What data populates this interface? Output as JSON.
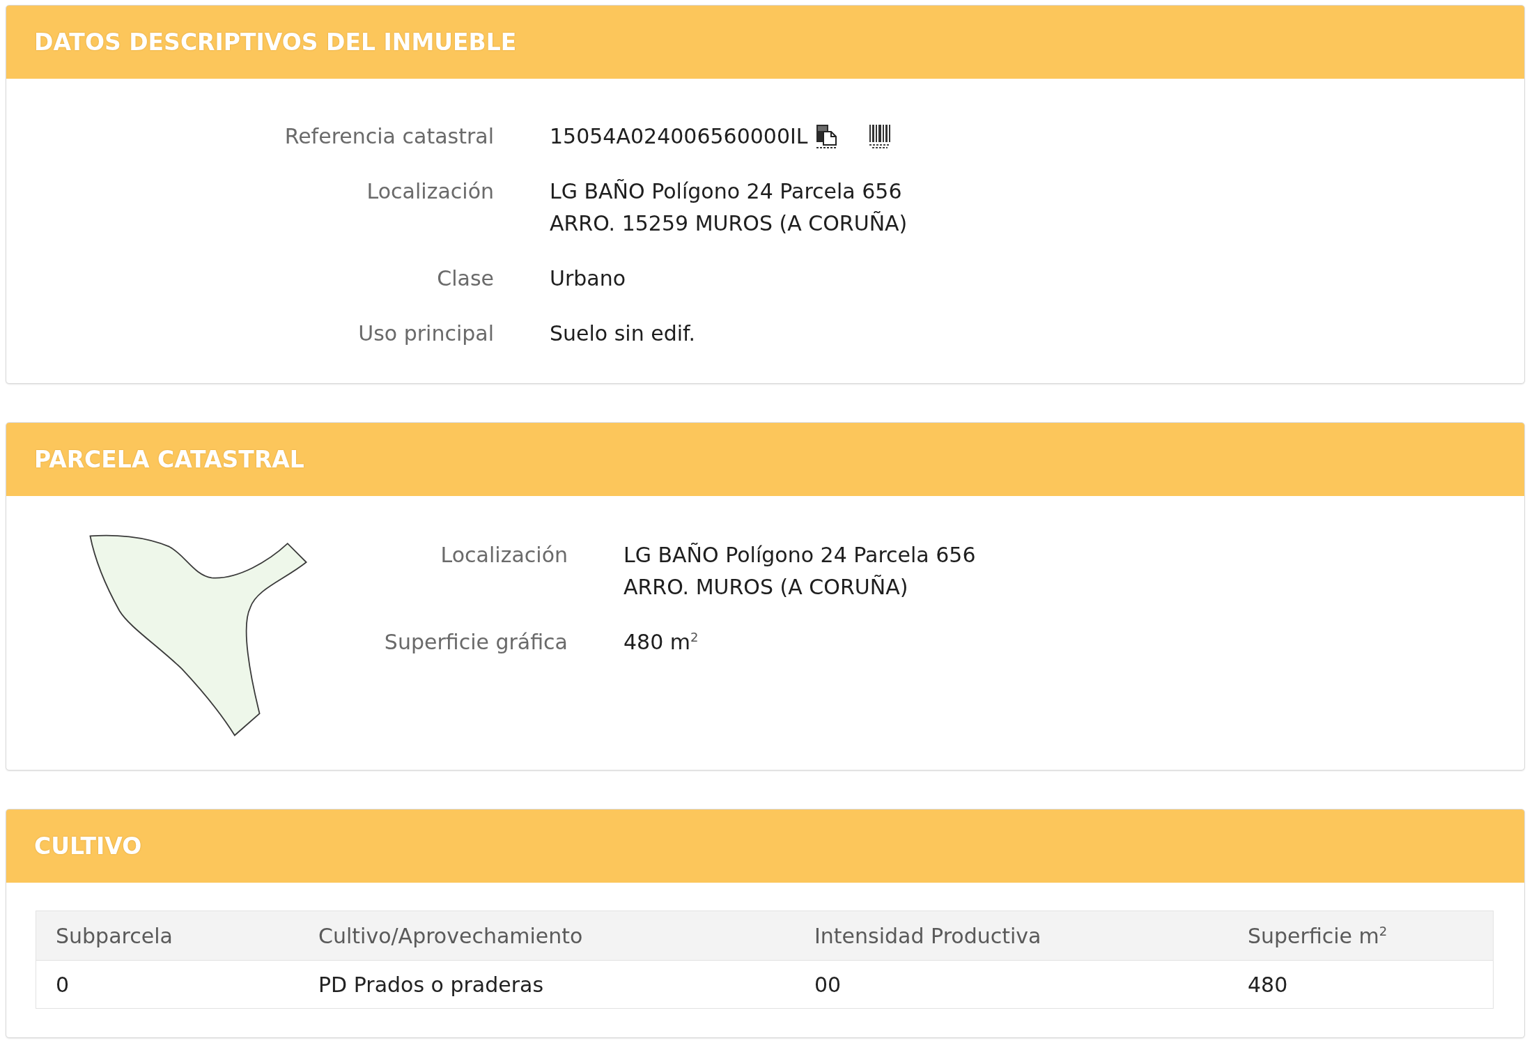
{
  "sections": [
    {
      "kind": "fields",
      "title": "DATOS DESCRIPTIVOS DEL INMUEBLE",
      "fields": [
        {
          "kind": "reference",
          "label": "Referencia catastral",
          "value": [
            "15054A024006560000IL"
          ]
        },
        {
          "kind": "text",
          "label": "Localización",
          "value": [
            "LG BAÑO Polígono 24 Parcela 656",
            "ARRO. 15259 MUROS (A CORUÑA)"
          ]
        },
        {
          "kind": "text",
          "label": "Clase",
          "value": [
            "Urbano"
          ]
        },
        {
          "kind": "text",
          "label": "Uso principal",
          "value": [
            "Suelo sin edif."
          ]
        }
      ]
    },
    {
      "kind": "parcel",
      "title": "PARCELA CATASTRAL",
      "fields": [
        {
          "kind": "text",
          "label": "Localización",
          "value": [
            "LG BAÑO Polígono 24 Parcela 656",
            "ARRO. MUROS (A CORUÑA)"
          ]
        },
        {
          "kind": "text",
          "label": "Superficie gráfica",
          "value": [
            "480 m$^{2}$"
          ]
        }
      ]
    },
    {
      "kind": "table",
      "title": "CULTIVO",
      "table": {
        "columns": [
          "Subparcela",
          "Cultivo/Aprovechamiento",
          "Intensidad Productiva",
          "Superficie m$^{2}$"
        ],
        "rows": [
          [
            "0",
            "PD Prados o praderas",
            "00",
            "480"
          ]
        ]
      }
    }
  ]
}
